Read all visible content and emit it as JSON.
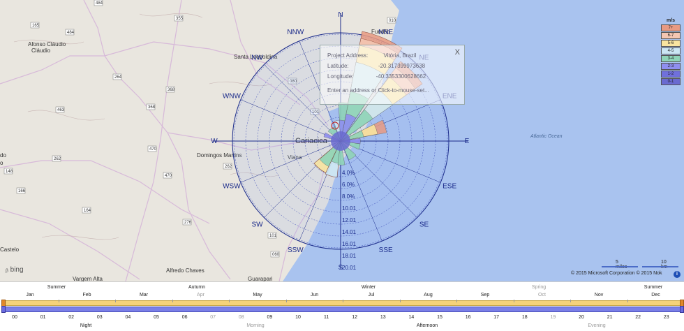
{
  "map": {
    "places": [
      "Afonso Cláudio",
      "Santa Leopoldina",
      "Fundão",
      "Cariacica",
      "Domingos Martins",
      "Viana",
      "Alfredo Chaves",
      "Guarapari",
      "Castelo",
      "Vargem Alta",
      "do",
      "o",
      "Vitória"
    ],
    "shields": [
      "484",
      "355",
      "165",
      "484",
      "264",
      "368",
      "463",
      "368",
      "470",
      "262",
      "148",
      "166",
      "164",
      "470",
      "276",
      "262",
      "101",
      "060",
      "101",
      "080",
      "101",
      "010"
    ],
    "ocean_label": "Atlantic Ocean",
    "bing": "bing",
    "credit": "© 2015 Microsoft Corporation   © 2015 Nok",
    "scale": {
      "miles": "5 miles",
      "km": "10 km"
    }
  },
  "rose": {
    "directions": [
      "N",
      "NNE",
      "NE",
      "ENE",
      "E",
      "ESE",
      "SE",
      "SSE",
      "S",
      "SSW",
      "SW",
      "WSW",
      "W",
      "WNW",
      "NW",
      "NNW"
    ],
    "pct_labels": [
      "4.0%",
      "6.0%",
      "8.0%",
      "10.01",
      "12.01",
      "14.01",
      "16.01",
      "18.01",
      "20.01"
    ]
  },
  "popup": {
    "address_label": "Project Address:",
    "address_value": "Vitória, Brazil",
    "lat_label": "Latitude:",
    "lat_value": "-20.317399973638",
    "lon_label": "Longitude:",
    "lon_value": "-40.3353300628662",
    "enter_label": "Enter an address or Click-to-mouse-set...",
    "close": "X"
  },
  "legend": {
    "title": "m/s",
    "bins": [
      {
        "label": "7+",
        "color": "#e89a82"
      },
      {
        "label": "6-7",
        "color": "#f4c6b2"
      },
      {
        "label": "5-6",
        "color": "#f8e4a0"
      },
      {
        "label": "4-5",
        "color": "#cbe6f4"
      },
      {
        "label": "3-4",
        "color": "#8fd4b8"
      },
      {
        "label": "2-3",
        "color": "#8f8ff0"
      },
      {
        "label": "1-2",
        "color": "#7070dc"
      },
      {
        "label": "0-1",
        "color": "#6a6ad0"
      }
    ]
  },
  "timeline": {
    "seasons": [
      {
        "label": "Summer",
        "dim": false
      },
      {
        "label": "Autumn",
        "dim": false
      },
      {
        "label": "Winter",
        "dim": false
      },
      {
        "label": "Spring",
        "dim": true
      },
      {
        "label": "Summer",
        "dim": false
      }
    ],
    "months": [
      {
        "label": "Jan",
        "dim": false
      },
      {
        "label": "Feb",
        "dim": false
      },
      {
        "label": "Mar",
        "dim": false
      },
      {
        "label": "Apr",
        "dim": true
      },
      {
        "label": "May",
        "dim": false
      },
      {
        "label": "Jun",
        "dim": false
      },
      {
        "label": "Jul",
        "dim": false
      },
      {
        "label": "Aug",
        "dim": false
      },
      {
        "label": "Sep",
        "dim": false
      },
      {
        "label": "Oct",
        "dim": true
      },
      {
        "label": "Nov",
        "dim": false
      },
      {
        "label": "Dec",
        "dim": false
      }
    ],
    "hours": [
      "00",
      "01",
      "02",
      "03",
      "04",
      "05",
      "06",
      "07",
      "08",
      "09",
      "10",
      "11",
      "12",
      "13",
      "14",
      "15",
      "16",
      "17",
      "18",
      "19",
      "20",
      "21",
      "22",
      "23"
    ],
    "hours_dim": [
      "07",
      "08",
      "19"
    ],
    "dayparts": [
      {
        "label": "Night",
        "dim": false
      },
      {
        "label": "Morning",
        "dim": true
      },
      {
        "label": "Afternoon",
        "dim": false
      },
      {
        "label": "Evening",
        "dim": true
      }
    ]
  }
}
